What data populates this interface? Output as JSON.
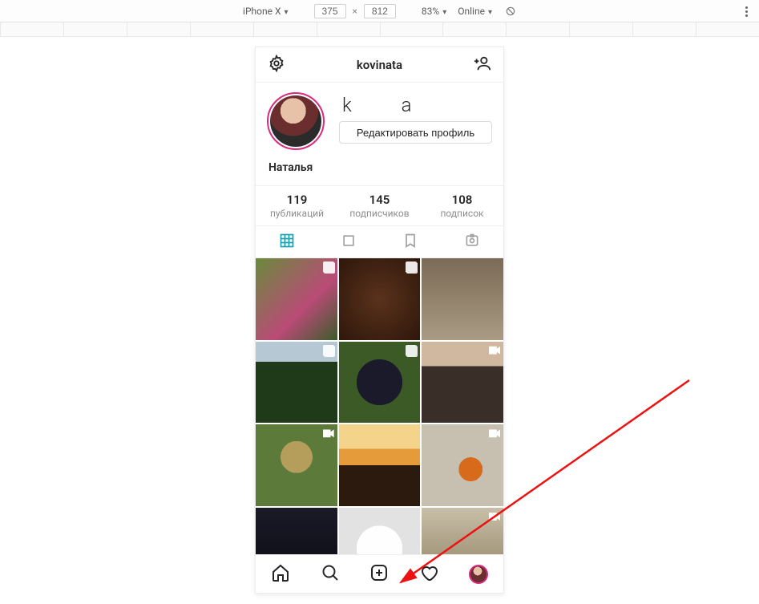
{
  "devtools": {
    "device": "iPhone X",
    "width": "375",
    "height": "812",
    "zoom": "83%",
    "throttle": "Online"
  },
  "header": {
    "username": "kovinata"
  },
  "profile": {
    "username_display": "k       a",
    "edit_button": "Редактировать профиль",
    "display_name": "Наталья"
  },
  "stats": {
    "posts_n": "119",
    "posts_l": "публикаций",
    "followers_n": "145",
    "followers_l": "подписчиков",
    "following_n": "108",
    "following_l": "подписок"
  },
  "tabs": [
    "grid",
    "feed",
    "saved",
    "tagged"
  ],
  "posts": [
    {
      "cls": "c-grapes",
      "badge": "multi"
    },
    {
      "cls": "c-brown",
      "badge": "multi"
    },
    {
      "cls": "c-debris",
      "badge": ""
    },
    {
      "cls": "c-tree",
      "badge": "multi"
    },
    {
      "cls": "c-berry",
      "badge": "multi"
    },
    {
      "cls": "c-wall",
      "badge": "video"
    },
    {
      "cls": "c-fig",
      "badge": "video"
    },
    {
      "cls": "c-sky",
      "badge": ""
    },
    {
      "cls": "c-rock",
      "badge": "video"
    },
    {
      "cls": "c-lap",
      "badge": ""
    },
    {
      "cls": "c-food",
      "badge": ""
    },
    {
      "cls": "c-plain",
      "badge": "video"
    }
  ]
}
